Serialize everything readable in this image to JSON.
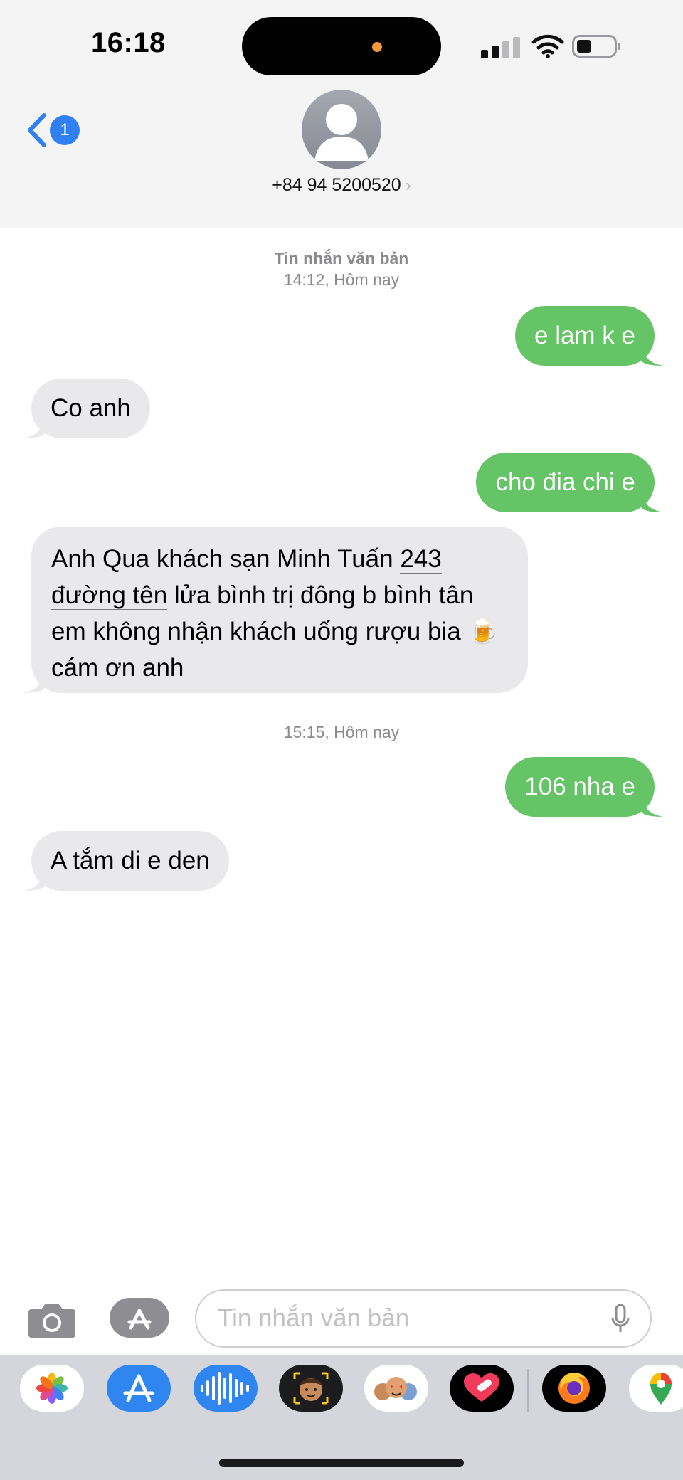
{
  "status_bar": {
    "time": "16:18"
  },
  "nav": {
    "back_badge": "1"
  },
  "contact": {
    "name": "+84 94 5200520",
    "chevron": "›"
  },
  "thread": {
    "ts1_label": "Tin nhắn văn bản",
    "ts1_time": "14:12, Hôm nay",
    "ts2_time": "15:15, Hôm nay",
    "messages": [
      {
        "dir": "sent",
        "text": "e lam k e"
      },
      {
        "dir": "received",
        "text": "Co anh"
      },
      {
        "dir": "sent",
        "text": "cho đia chi e"
      },
      {
        "dir": "received",
        "text_part1": "Anh Qua khách sạn Minh Tuấn  ",
        "text_link": "243 đường tên",
        "text_part2": " lửa bình trị đông b bình tân em không nhận khách uống rượu bia ",
        "text_emoji": "🍺",
        "text_part3": " cám ơn anh"
      },
      {
        "dir": "sent",
        "text": "106 nha e"
      },
      {
        "dir": "received",
        "text": "A tắm di e den"
      }
    ]
  },
  "composer": {
    "placeholder": "Tin nhắn văn bản"
  },
  "app_strip": {
    "apps": [
      "photos-icon",
      "app-store-icon",
      "audio-message-icon",
      "memoji-icon",
      "memoji-stickers-icon",
      "digital-touch-icon",
      "firefox-icon",
      "google-maps-icon"
    ]
  },
  "colors": {
    "sent_bubble": "#65c466",
    "received_bubble": "#e9e9eb",
    "accent": "#2f7ff5"
  }
}
